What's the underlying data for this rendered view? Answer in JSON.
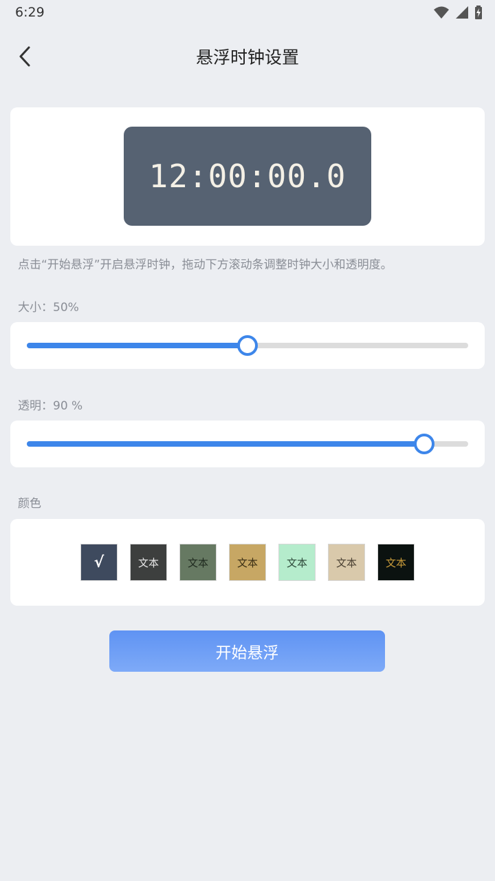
{
  "status_bar": {
    "time": "6:29",
    "icons": [
      "wifi-icon",
      "signal-icon",
      "battery-icon"
    ]
  },
  "header": {
    "back_icon": "chevron-left-icon",
    "title": "悬浮时钟设置"
  },
  "preview": {
    "clock_text": "12:00:00.0",
    "background_color": "#566272",
    "text_color": "#f4f0e6"
  },
  "hint": "点击“开始悬浮”开启悬浮时钟，拖动下方滚动条调整时钟大小和透明度。",
  "size": {
    "label": "大小：50%",
    "value_percent": 50
  },
  "opacity": {
    "label": "透明：90 %",
    "value_percent": 90
  },
  "colors": {
    "label": "颜色",
    "swatches": [
      {
        "text": "√",
        "bg": "#3e4a5e",
        "fg": "#ffffff",
        "selected": true
      },
      {
        "text": "文本",
        "bg": "#3d3f3e",
        "fg": "#e6e6e6",
        "selected": false
      },
      {
        "text": "文本",
        "bg": "#667962",
        "fg": "#1f2a1f",
        "selected": false
      },
      {
        "text": "文本",
        "bg": "#c7a764",
        "fg": "#3a2e14",
        "selected": false
      },
      {
        "text": "文本",
        "bg": "#b5eccc",
        "fg": "#2e4a3a",
        "selected": false
      },
      {
        "text": "文本",
        "bg": "#d9c9ab",
        "fg": "#4a4032",
        "selected": false
      },
      {
        "text": "文本",
        "bg": "#0b1210",
        "fg": "#c79a3a",
        "selected": false
      }
    ]
  },
  "start_button": {
    "label": "开始悬浮"
  },
  "accent_color": "#3d86ea"
}
